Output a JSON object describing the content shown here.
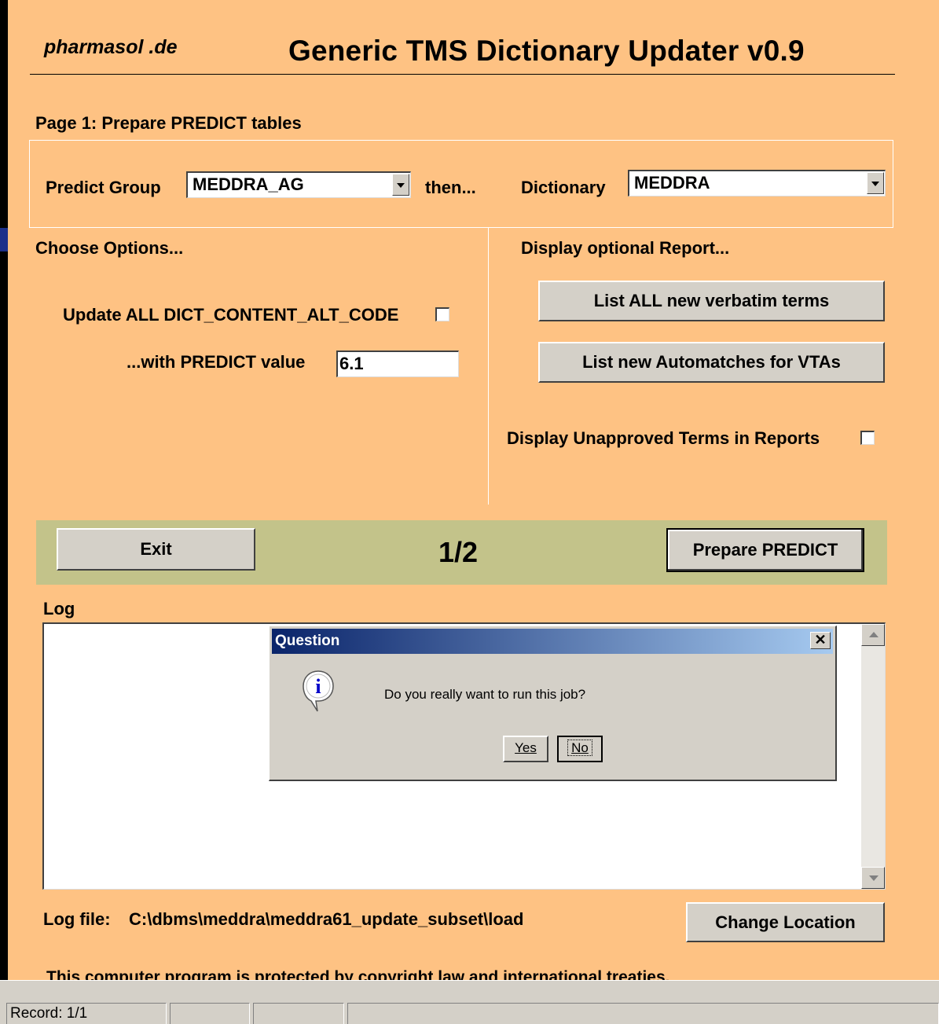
{
  "header": {
    "brand": "pharmasol .de",
    "title": "Generic TMS Dictionary Updater v0.9"
  },
  "page": {
    "heading": "Page 1: Prepare PREDICT tables"
  },
  "selection": {
    "predict_group_label": "Predict Group",
    "predict_group_value": "MEDDRA_AG",
    "then_label": "then...",
    "dictionary_label": "Dictionary",
    "dictionary_value": "MEDDRA"
  },
  "options": {
    "heading": "Choose Options...",
    "update_alt_code_label": "Update ALL DICT_CONTENT_ALT_CODE",
    "update_alt_code_checked": false,
    "predict_value_label": "...with PREDICT value",
    "predict_value": "6.1"
  },
  "reports": {
    "heading": "Display optional Report...",
    "list_verbatim_label": "List ALL new verbatim terms",
    "list_automatches_label": "List new Automatches for VTAs",
    "unapproved_label": "Display Unapproved Terms in Reports",
    "unapproved_checked": false
  },
  "navigation": {
    "exit_label": "Exit",
    "page_indicator": "1/2",
    "prepare_label": "Prepare PREDICT"
  },
  "log": {
    "label": "Log",
    "file_label": "Log file:",
    "file_path": "C:\\dbms\\meddra\\meddra61_update_subset\\load",
    "change_location_label": "Change Location"
  },
  "copyright": "This computer program is protected by copyright law and international treaties.",
  "dialog": {
    "title": "Question",
    "message": "Do you really want to run this job?",
    "yes_label": "Yes",
    "no_label": "No",
    "icon": "info-icon"
  },
  "statusbar": {
    "record": "Record: 1/1"
  },
  "colors": {
    "form_background": "#fec283",
    "nav_band": "#c3c38a",
    "title_bar_start": "#0a246a",
    "title_bar_end": "#a6caf0"
  }
}
